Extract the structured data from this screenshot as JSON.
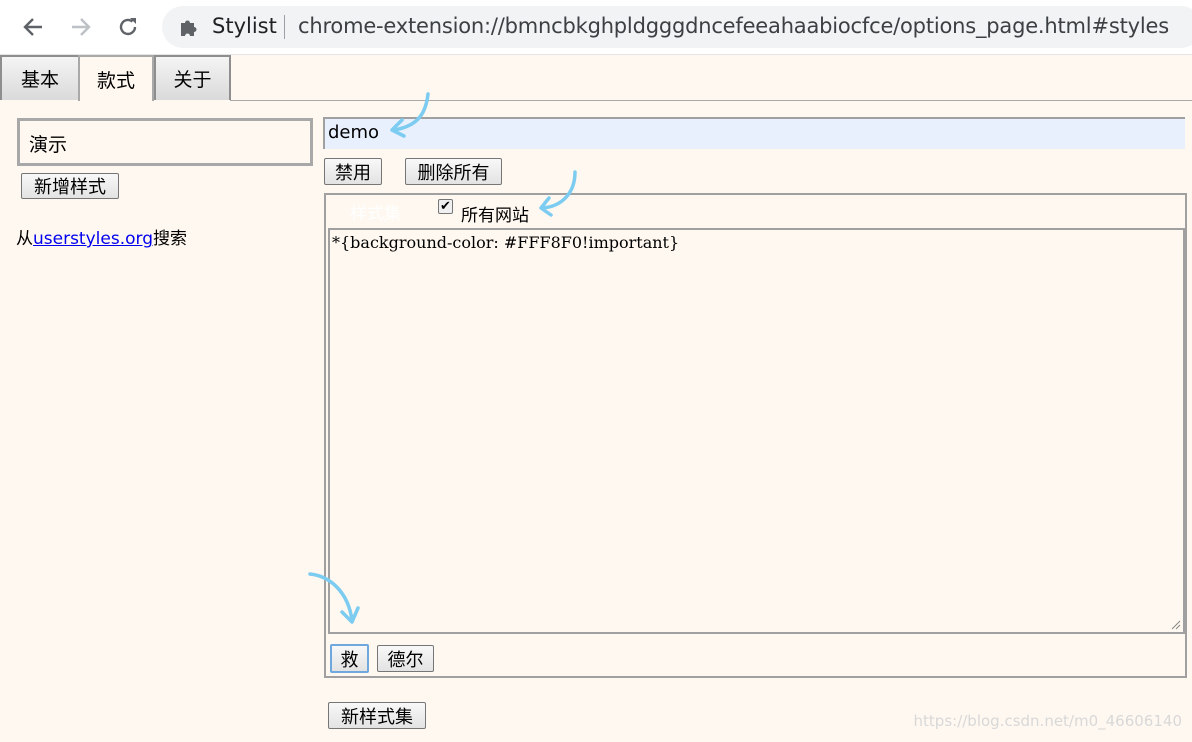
{
  "browser": {
    "extension_name": "Stylist",
    "url": "chrome-extension://bmncbkghpldgggdncefeeahaabiocfce/options_page.html#styles"
  },
  "tabs": [
    {
      "label": "基本"
    },
    {
      "label": "款式"
    },
    {
      "label": "关于"
    }
  ],
  "sidebar": {
    "style_name": "演示",
    "add_style_label": "新增样式",
    "search_prefix": "从",
    "search_link": "userstyles.org",
    "search_suffix": "搜索"
  },
  "editor": {
    "name_value": "demo",
    "disable_label": "禁用",
    "delete_all_label": "删除所有",
    "section_title": "样式集",
    "all_sites_label": "所有网站",
    "all_sites_checked": true,
    "code": "*{background-color: #FFF8F0!important}",
    "save_label": "救",
    "delete_label": "德尔",
    "new_set_label": "新样式集"
  },
  "watermark": "https://blog.csdn.net/m0_46606140",
  "colors": {
    "page_background": "#FFF8F0",
    "input_background": "#E8F0FE",
    "annotation_arrow": "#7CCBF0",
    "link": "#0000EE"
  }
}
